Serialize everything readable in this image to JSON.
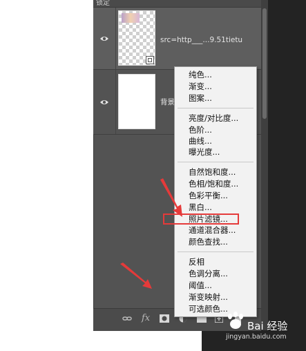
{
  "layers": [
    {
      "name": "src=http___...9.51tietu",
      "visible": true,
      "kind": "smart-object"
    },
    {
      "name": "背景",
      "visible": true,
      "kind": "background"
    }
  ],
  "header_label": "锁定",
  "adjustment_menu": {
    "groups": [
      [
        "纯色...",
        "渐变...",
        "图案..."
      ],
      [
        "亮度/对比度...",
        "色阶...",
        "曲线...",
        "曝光度..."
      ],
      [
        "自然饱和度...",
        "色相/饱和度...",
        "色彩平衡...",
        "黑白...",
        "照片滤镜...",
        "通道混合器...",
        "颜色查找..."
      ],
      [
        "反相",
        "色调分离...",
        "阈值...",
        "渐变映射...",
        "可选颜色..."
      ]
    ],
    "highlighted_item": "照片滤镜..."
  },
  "footer_icons": [
    "link-icon",
    "fx-icon",
    "mask-icon",
    "adjustment-icon",
    "group-icon",
    "new-layer-icon",
    "delete-icon"
  ],
  "footer_fx_label": "fx",
  "watermark": {
    "brand": "Bai 经验",
    "url": "jingyan.baidu.com"
  },
  "colors": {
    "panel": "#535353",
    "menu": "#f2f2f2",
    "highlight": "#e53a3a",
    "arrow": "#e53a3a"
  }
}
